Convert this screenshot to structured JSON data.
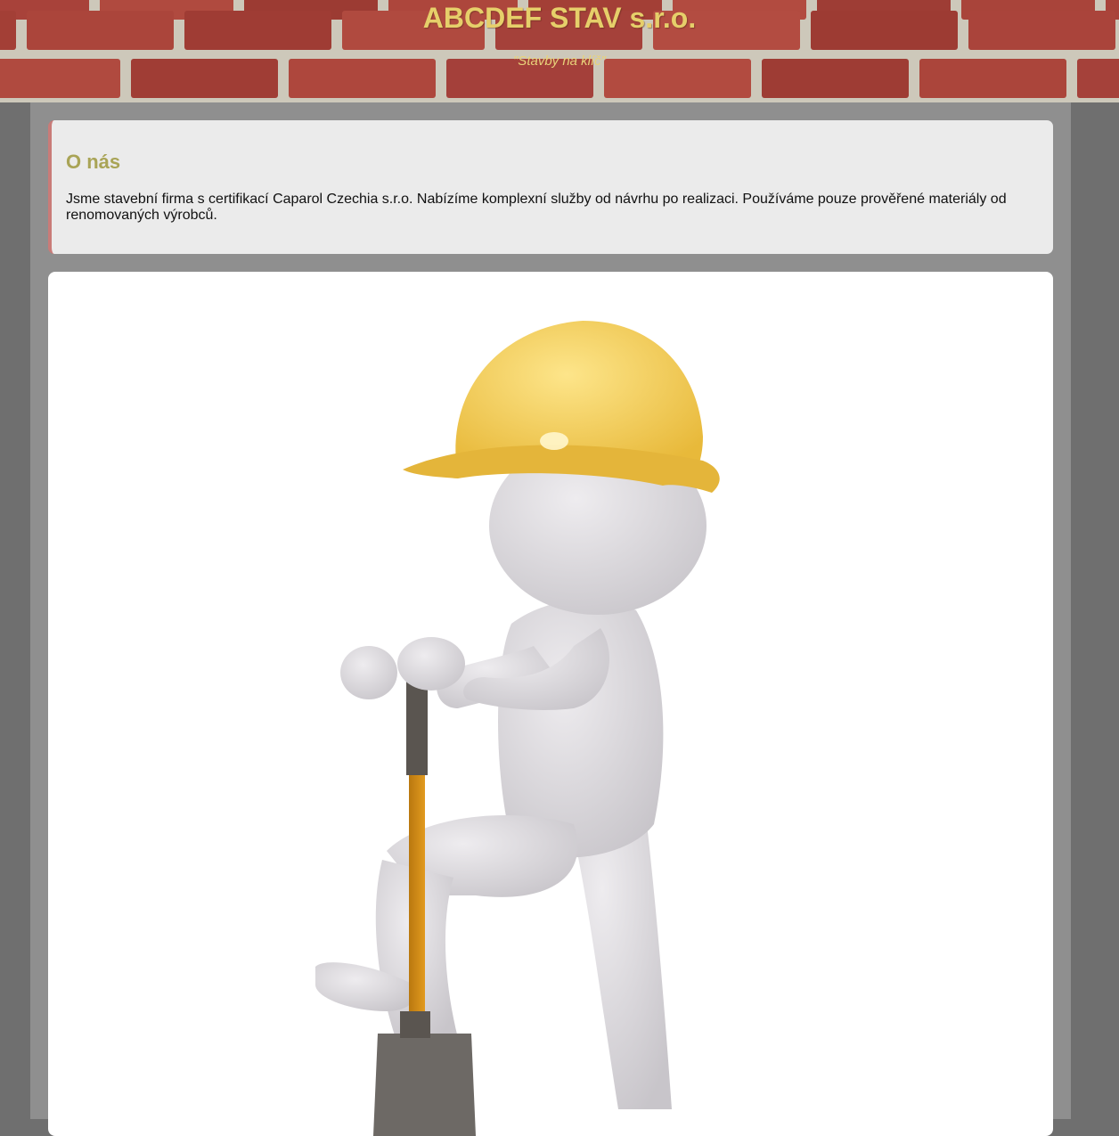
{
  "header": {
    "title": "ABCDEF STAV s.r.o.",
    "slogan": "\"Stavby na klíč\""
  },
  "about": {
    "title": "O nás",
    "text": "Jsme stavební firma s certifikací Caparol Czechia s.r.o. Nabízíme komplexní služby od návrhu po realizaci. Používáme pouze prověřené materiály od renomovaných výrobců."
  },
  "colors": {
    "title": "#e6cf6a",
    "about_heading": "#a9a456",
    "brick": "#a8423a",
    "column": "#8f8f8f",
    "page": "#6f6f6f"
  },
  "illustration": {
    "icon": "construction-worker-with-shovel-illustration"
  }
}
